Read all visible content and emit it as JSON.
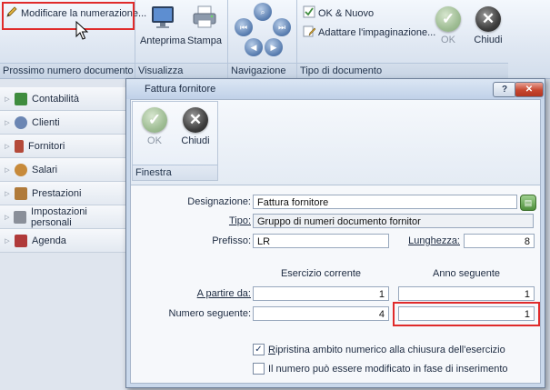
{
  "ribbon": {
    "groups": {
      "numbering": {
        "label": "Prossimo numero documento",
        "button_label": "Modificare la numerazione..."
      },
      "view": {
        "label": "Visualizza",
        "preview_label": "Anteprima",
        "print_label": "Stampa"
      },
      "navigation": {
        "label": "Navigazione"
      },
      "doctype": {
        "label": "Tipo di documento",
        "ok_new_label": "OK & Nuovo",
        "adapt_layout_label": "Adattare l'impaginazione...",
        "ok_label": "OK",
        "close_label": "Chiudi"
      }
    }
  },
  "sidebar": {
    "items": [
      {
        "label": "Contabilità",
        "icon": "ledger-icon",
        "color": "#3e8c3e"
      },
      {
        "label": "Clienti",
        "icon": "customers-icon",
        "color": "#6b86b3"
      },
      {
        "label": "Fornitori",
        "icon": "suppliers-icon",
        "color": "#b44a3a"
      },
      {
        "label": "Salari",
        "icon": "salaries-icon",
        "color": "#c78a3b"
      },
      {
        "label": "Prestazioni",
        "icon": "services-icon",
        "color": "#b07a3a"
      },
      {
        "label": "Impostazioni personali",
        "icon": "tools-icon",
        "color": "#8a8f99"
      },
      {
        "label": "Agenda",
        "icon": "agenda-icon",
        "color": "#b03a3a"
      }
    ]
  },
  "dialog": {
    "title": "Fattura fornitore",
    "help_label": "?",
    "close_label": "✕",
    "toolbar": {
      "ok_label": "OK",
      "close_label": "Chiudi",
      "group_label": "Finestra"
    },
    "form": {
      "designation_label": "Designazione:",
      "designation_value": "Fattura fornitore",
      "type_label": "Tipo:",
      "type_value": "Gruppo di numeri documento fornitor",
      "prefix_label": "Prefisso:",
      "prefix_value": "LR",
      "length_label": "Lunghezza:",
      "length_value": "8",
      "col_current": "Esercizio corrente",
      "col_next": "Anno seguente",
      "from_label": "A partire da:",
      "from_current": "1",
      "from_next": "1",
      "next_number_label": "Numero seguente:",
      "next_current": "4",
      "next_next": "1",
      "reset_checkbox_label": "Ripristina ambito numerico alla chiusura dell'esercizio",
      "reset_checked": true,
      "editable_checkbox_label": "Il numero può essere modificato in fase di inserimento",
      "editable_checked": false
    }
  },
  "colors": {
    "highlight": "#e02b2b",
    "accent": "#4f8f3c"
  }
}
